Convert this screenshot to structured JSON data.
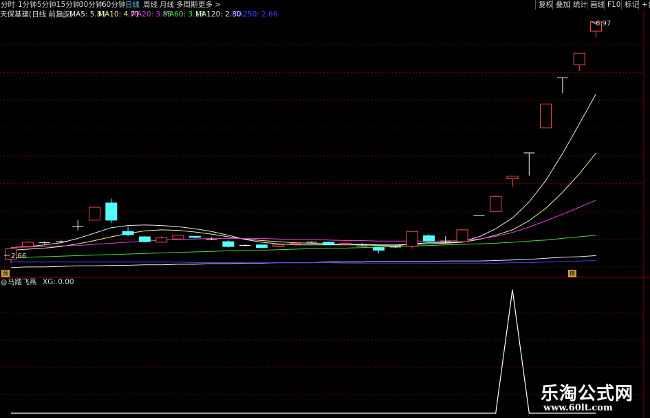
{
  "toolbar": {
    "periods": [
      "分时",
      "1分钟",
      "5分钟",
      "15分钟",
      "30分钟",
      "60分钟",
      "日线",
      "周线",
      "月线",
      "多周期",
      "更多 >"
    ],
    "active_period": "日线",
    "tools": [
      "复权",
      "叠加",
      "统计",
      "画线",
      "F10",
      "标记",
      "+自"
    ]
  },
  "stock_title": "天保基建(日线 前复权)",
  "ma_labels": [
    {
      "text": "MA5: 5.81",
      "color": "#e8e8e8"
    },
    {
      "text": "MA10: 4.71",
      "color": "#f0f0a0"
    },
    {
      "text": "MA20: 3.83",
      "color": "#e040e0"
    },
    {
      "text": "MA60: 3.18",
      "color": "#40e040"
    },
    {
      "text": "MA120: 2.80",
      "color": "#e8e8e8"
    },
    {
      "text": "MA250: 2.66",
      "color": "#4040ff"
    }
  ],
  "indicator": {
    "name": "马踏飞燕",
    "value_text": "XG: 0.00"
  },
  "badges": [
    "预",
    "榜"
  ],
  "watermark": {
    "text": "乐淘公式网",
    "url": "www.60lt.com"
  },
  "chart_data": {
    "type": "candlestick",
    "price_axis": {
      "max": 6.97,
      "min": 2.66,
      "max_label": "6.97",
      "min_label": "2.66"
    },
    "colors": {
      "up": "#ff5050",
      "down": "#54ffff",
      "flat": "#ffffff",
      "grid": "#6a0000"
    },
    "candles": [
      {
        "o": 2.73,
        "c": 2.93,
        "h": 2.93,
        "l": 2.66
      },
      {
        "o": 2.97,
        "c": 3.05,
        "h": 3.07,
        "l": 2.96
      },
      {
        "o": 3.04,
        "c": 3.04,
        "h": 3.06,
        "l": 3.02
      },
      {
        "o": 3.06,
        "c": 3.06,
        "h": 3.08,
        "l": 3.04
      },
      {
        "o": 3.34,
        "c": 3.34,
        "h": 3.47,
        "l": 3.27
      },
      {
        "o": 3.46,
        "c": 3.7,
        "h": 3.7,
        "l": 3.46
      },
      {
        "o": 3.78,
        "c": 3.46,
        "h": 3.86,
        "l": 3.4
      },
      {
        "o": 3.25,
        "c": 3.19,
        "h": 3.34,
        "l": 3.16
      },
      {
        "o": 3.15,
        "c": 3.06,
        "h": 3.16,
        "l": 3.05
      },
      {
        "o": 3.05,
        "c": 3.13,
        "h": 3.16,
        "l": 3.04
      },
      {
        "o": 3.11,
        "c": 3.18,
        "h": 3.18,
        "l": 3.11
      },
      {
        "o": 3.16,
        "c": 3.14,
        "h": 3.16,
        "l": 3.12
      },
      {
        "o": 3.1,
        "c": 3.1,
        "h": 3.14,
        "l": 3.09
      },
      {
        "o": 3.06,
        "c": 2.97,
        "h": 3.09,
        "l": 2.95
      },
      {
        "o": 2.99,
        "c": 2.99,
        "h": 3.01,
        "l": 2.97
      },
      {
        "o": 3.0,
        "c": 2.95,
        "h": 3.0,
        "l": 2.94
      },
      {
        "o": 2.97,
        "c": 3.0,
        "h": 3.0,
        "l": 2.96
      },
      {
        "o": 3.01,
        "c": 3.03,
        "h": 3.03,
        "l": 3.0
      },
      {
        "o": 3.05,
        "c": 3.05,
        "h": 3.07,
        "l": 3.03
      },
      {
        "o": 3.05,
        "c": 3.01,
        "h": 3.06,
        "l": 3.0
      },
      {
        "o": 3.01,
        "c": 3.03,
        "h": 3.04,
        "l": 3.0
      },
      {
        "o": 2.98,
        "c": 2.98,
        "h": 3.03,
        "l": 2.97
      },
      {
        "o": 2.95,
        "c": 2.9,
        "h": 2.97,
        "l": 2.84
      },
      {
        "o": 2.96,
        "c": 2.96,
        "h": 3.0,
        "l": 2.94
      },
      {
        "o": 2.97,
        "c": 3.25,
        "h": 3.25,
        "l": 2.93
      },
      {
        "o": 3.17,
        "c": 3.07,
        "h": 3.2,
        "l": 3.06
      },
      {
        "o": 3.07,
        "c": 3.07,
        "h": 3.16,
        "l": 3.03
      },
      {
        "o": 3.06,
        "c": 3.28,
        "h": 3.29,
        "l": 3.04
      },
      {
        "o": 3.55,
        "c": 3.55,
        "h": 3.55,
        "l": 3.55
      },
      {
        "o": 3.62,
        "c": 3.9,
        "h": 3.92,
        "l": 3.62
      },
      {
        "o": 4.23,
        "c": 4.28,
        "h": 4.28,
        "l": 4.08
      },
      {
        "o": 4.71,
        "c": 4.71,
        "h": 4.71,
        "l": 4.29
      },
      {
        "o": 5.18,
        "c": 5.62,
        "h": 5.62,
        "l": 5.18
      },
      {
        "o": 6.11,
        "c": 6.11,
        "h": 6.11,
        "l": 5.82
      },
      {
        "o": 6.35,
        "c": 6.57,
        "h": 6.57,
        "l": 6.24
      },
      {
        "o": 6.98,
        "c": 7.15,
        "h": 7.15,
        "l": 6.85
      }
    ],
    "ma_series": [
      {
        "label": "MA5",
        "color": "#e8e8e8",
        "values": [
          2.95,
          2.97,
          3.0,
          3.04,
          3.12,
          3.22,
          3.32,
          3.36,
          3.37,
          3.36,
          3.34,
          3.3,
          3.25,
          3.18,
          3.1,
          3.05,
          3.02,
          3.0,
          3.0,
          3.0,
          3.0,
          3.0,
          2.99,
          2.98,
          3.02,
          3.04,
          3.04,
          3.06,
          3.15,
          3.3,
          3.5,
          3.8,
          4.2,
          4.7,
          5.25,
          5.81
        ]
      },
      {
        "label": "MA10",
        "color": "#f0f0a0",
        "values": [
          2.9,
          2.92,
          2.94,
          2.97,
          3.02,
          3.08,
          3.15,
          3.21,
          3.26,
          3.28,
          3.27,
          3.24,
          3.2,
          3.15,
          3.11,
          3.08,
          3.06,
          3.04,
          3.03,
          3.02,
          3.01,
          3.01,
          3.0,
          3.0,
          3.01,
          3.02,
          3.03,
          3.05,
          3.1,
          3.18,
          3.28,
          3.45,
          3.68,
          3.98,
          4.32,
          4.71
        ]
      },
      {
        "label": "MA20",
        "color": "#e040e0",
        "values": [
          2.95,
          2.96,
          2.97,
          2.98,
          2.99,
          3.01,
          3.03,
          3.05,
          3.07,
          3.09,
          3.1,
          3.11,
          3.12,
          3.12,
          3.12,
          3.12,
          3.11,
          3.1,
          3.1,
          3.09,
          3.08,
          3.08,
          3.07,
          3.07,
          3.07,
          3.07,
          3.07,
          3.08,
          3.11,
          3.16,
          3.23,
          3.33,
          3.45,
          3.57,
          3.7,
          3.83
        ]
      },
      {
        "label": "MA60",
        "color": "#40e040",
        "values": [
          2.76,
          2.77,
          2.78,
          2.79,
          2.8,
          2.81,
          2.82,
          2.83,
          2.84,
          2.85,
          2.86,
          2.87,
          2.88,
          2.89,
          2.9,
          2.9,
          2.91,
          2.92,
          2.93,
          2.94,
          2.94,
          2.95,
          2.96,
          2.97,
          2.98,
          2.99,
          3.0,
          3.01,
          3.02,
          3.03,
          3.05,
          3.07,
          3.09,
          3.12,
          3.15,
          3.18
        ]
      },
      {
        "label": "MA120",
        "color": "#e8e8e8",
        "values": [
          2.58,
          2.59,
          2.59,
          2.6,
          2.61,
          2.61,
          2.62,
          2.62,
          2.63,
          2.63,
          2.64,
          2.64,
          2.65,
          2.65,
          2.66,
          2.66,
          2.67,
          2.67,
          2.67,
          2.68,
          2.68,
          2.68,
          2.69,
          2.69,
          2.69,
          2.69,
          2.7,
          2.7,
          2.7,
          2.71,
          2.72,
          2.73,
          2.75,
          2.77,
          2.78,
          2.8
        ]
      },
      {
        "label": "MA250",
        "color": "#4040ff",
        "values": [
          2.68,
          2.68,
          2.68,
          2.68,
          2.68,
          2.68,
          2.68,
          2.68,
          2.68,
          2.68,
          2.68,
          2.67,
          2.67,
          2.67,
          2.67,
          2.67,
          2.67,
          2.67,
          2.67,
          2.67,
          2.66,
          2.66,
          2.66,
          2.66,
          2.66,
          2.66,
          2.66,
          2.66,
          2.66,
          2.66,
          2.67,
          2.67,
          2.68,
          2.69,
          2.7,
          2.71
        ]
      }
    ],
    "xg_signal": {
      "label": "XG",
      "color": "#ffffff",
      "values": [
        0,
        0,
        0,
        0,
        0,
        0,
        0,
        0,
        0,
        0,
        0,
        0,
        0,
        0,
        0,
        0,
        0,
        0,
        0,
        0,
        0,
        0,
        0,
        0,
        0,
        0,
        0,
        0,
        0,
        0,
        1,
        0,
        0,
        0,
        0,
        0
      ]
    }
  }
}
